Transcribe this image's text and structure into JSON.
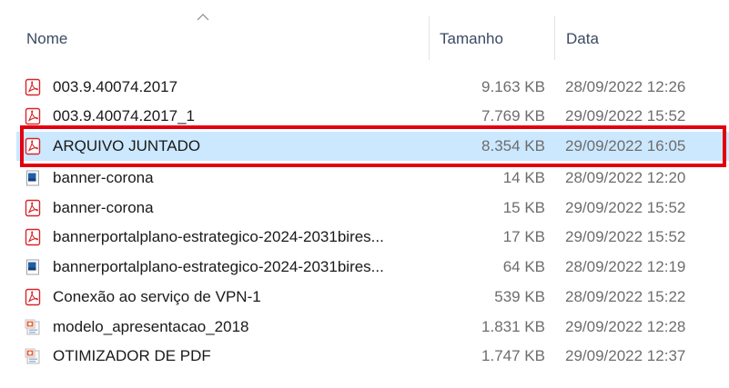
{
  "columns": {
    "name": "Nome",
    "size": "Tamanho",
    "date": "Data"
  },
  "files": [
    {
      "name": "003.9.40074.2017",
      "size": "9.163 KB",
      "date": "28/09/2022 12:26",
      "icon": "pdf-icon"
    },
    {
      "name": "003.9.40074.2017_1",
      "size": "7.769 KB",
      "date": "29/09/2022 15:52",
      "icon": "pdf-icon"
    },
    {
      "name": "ARQUIVO JUNTADO",
      "size": "8.354 KB",
      "date": "29/09/2022 16:05",
      "icon": "pdf-icon",
      "selected": true
    },
    {
      "name": "banner-corona",
      "size": "14 KB",
      "date": "28/09/2022 12:20",
      "icon": "image-icon"
    },
    {
      "name": "banner-corona",
      "size": "15 KB",
      "date": "29/09/2022 15:52",
      "icon": "pdf-icon"
    },
    {
      "name": "bannerportalplano-estrategico-2024-2031bires...",
      "size": "17 KB",
      "date": "29/09/2022 15:52",
      "icon": "pdf-icon"
    },
    {
      "name": "bannerportalplano-estrategico-2024-2031bires...",
      "size": "64 KB",
      "date": "28/09/2022 12:19",
      "icon": "image-icon"
    },
    {
      "name": "Conexão ao serviço de VPN-1",
      "size": "539 KB",
      "date": "28/09/2022 15:22",
      "icon": "pdf-icon"
    },
    {
      "name": "modelo_apresentacao_2018",
      "size": "1.831 KB",
      "date": "29/09/2022 12:28",
      "icon": "presentation-icon"
    },
    {
      "name": "OTIMIZADOR DE PDF",
      "size": "1.747 KB",
      "date": "29/09/2022 12:37",
      "icon": "presentation-icon"
    }
  ],
  "colors": {
    "selection": "#cce8ff",
    "highlight_border": "#e2000f",
    "pdf_red": "#d7262b"
  }
}
